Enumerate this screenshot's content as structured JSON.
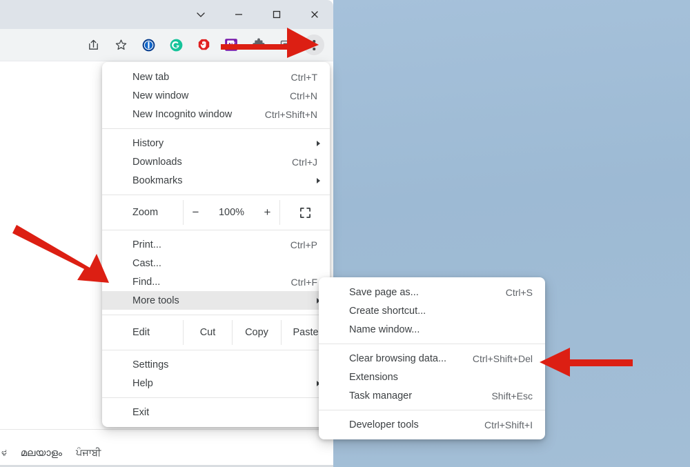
{
  "window": {
    "controls": [
      {
        "name": "chevron-down-button",
        "icon": "chevron-down-icon"
      },
      {
        "name": "minimize-button",
        "icon": "minimize-icon"
      },
      {
        "name": "maximize-button",
        "icon": "maximize-icon"
      },
      {
        "name": "close-button",
        "icon": "close-icon"
      }
    ]
  },
  "toolbar": {
    "icons": [
      {
        "name": "share-icon",
        "label": "Share"
      },
      {
        "name": "bookmark-star-icon",
        "label": "Bookmark this tab"
      },
      {
        "name": "onepassword-extension-icon",
        "label": "1Password"
      },
      {
        "name": "grammarly-extension-icon",
        "label": "Grammarly"
      },
      {
        "name": "adblock-extension-icon",
        "label": "AdBlock"
      },
      {
        "name": "onenote-extension-icon",
        "label": "OneNote Web Clipper"
      },
      {
        "name": "extensions-puzzle-icon",
        "label": "Extensions"
      },
      {
        "name": "cast-screen-icon",
        "label": "Cast"
      },
      {
        "name": "chrome-menu-kebab-icon",
        "label": "Customize and control Google Chrome"
      }
    ]
  },
  "page": {
    "mic_icon": "google-voice-search-icon",
    "lens_icon": "google-lens-icon",
    "languages": [
      "ಳ",
      "മലയാളം",
      "ਪੰਜਾਬੀ"
    ]
  },
  "main_menu": {
    "groups": [
      {
        "items": [
          {
            "label": "New tab",
            "accel": "Ctrl+T",
            "submenu": false
          },
          {
            "label": "New window",
            "accel": "Ctrl+N",
            "submenu": false
          },
          {
            "label": "New Incognito window",
            "accel": "Ctrl+Shift+N",
            "submenu": false
          }
        ]
      },
      {
        "items": [
          {
            "label": "History",
            "accel": "",
            "submenu": true
          },
          {
            "label": "Downloads",
            "accel": "Ctrl+J",
            "submenu": false
          },
          {
            "label": "Bookmarks",
            "accel": "",
            "submenu": true
          }
        ]
      }
    ],
    "zoom_row": {
      "label": "Zoom",
      "minus": "−",
      "percent": "100%",
      "plus": "+",
      "fullscreen_icon": "fullscreen-icon"
    },
    "group_print": {
      "items": [
        {
          "label": "Print...",
          "accel": "Ctrl+P",
          "submenu": false
        },
        {
          "label": "Cast...",
          "accel": "",
          "submenu": false
        },
        {
          "label": "Find...",
          "accel": "Ctrl+F",
          "submenu": false
        },
        {
          "label": "More tools",
          "accel": "",
          "submenu": true,
          "hovered": true
        }
      ]
    },
    "edit_row": {
      "label": "Edit",
      "cut": "Cut",
      "copy": "Copy",
      "paste": "Paste"
    },
    "group_settings": {
      "items": [
        {
          "label": "Settings",
          "accel": "",
          "submenu": false
        },
        {
          "label": "Help",
          "accel": "",
          "submenu": true
        }
      ]
    },
    "group_exit": {
      "items": [
        {
          "label": "Exit",
          "accel": "",
          "submenu": false
        }
      ]
    }
  },
  "sub_menu": {
    "groups": [
      {
        "items": [
          {
            "label": "Save page as...",
            "accel": "Ctrl+S"
          },
          {
            "label": "Create shortcut...",
            "accel": ""
          },
          {
            "label": "Name window...",
            "accel": ""
          }
        ]
      },
      {
        "items": [
          {
            "label": "Clear browsing data...",
            "accel": "Ctrl+Shift+Del"
          },
          {
            "label": "Extensions",
            "accel": ""
          },
          {
            "label": "Task manager",
            "accel": "Shift+Esc"
          }
        ]
      },
      {
        "items": [
          {
            "label": "Developer tools",
            "accel": "Ctrl+Shift+I"
          }
        ]
      }
    ]
  },
  "annotations": {
    "color": "#DC1F13",
    "arrows": [
      {
        "name": "arrow-to-chrome-menu",
        "target": "chrome-menu-kebab-icon",
        "direction": "right"
      },
      {
        "name": "arrow-to-more-tools",
        "target": "More tools",
        "direction": "down-right"
      },
      {
        "name": "arrow-to-clear-browsing-data",
        "target": "Clear browsing data...",
        "direction": "left"
      }
    ]
  },
  "colors": {
    "desktop": "#9fbbd4",
    "titlebar": "#dee3e9",
    "toolbar": "#f1f3f4",
    "menu_bg": "#ffffff",
    "menu_text": "#3c4043",
    "accel_text": "#5f6368",
    "hover_bg": "#e8e8e8",
    "annotation_red": "#DC1F13"
  }
}
